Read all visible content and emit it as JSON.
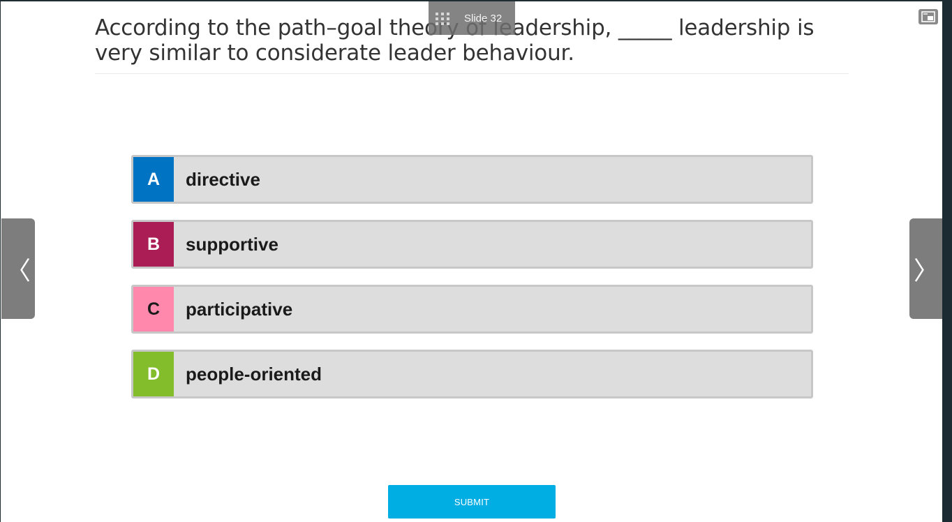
{
  "header": {
    "slide_label": "Slide 32"
  },
  "question": {
    "line1": "According to the path–goal theory of leadership, _____ leadership is",
    "line2": "very similar to considerate leader behaviour."
  },
  "options": [
    {
      "letter": "A",
      "text": "directive",
      "color": "#0073c2"
    },
    {
      "letter": "B",
      "text": "supportive",
      "color": "#ab1e55"
    },
    {
      "letter": "C",
      "text": "participative",
      "color": "#ff88ac"
    },
    {
      "letter": "D",
      "text": "people-oriented",
      "color": "#84bd2c"
    }
  ],
  "nav": {
    "prev_glyph": "〈",
    "next_glyph": "〉"
  },
  "submit_label": "SUBMIT"
}
